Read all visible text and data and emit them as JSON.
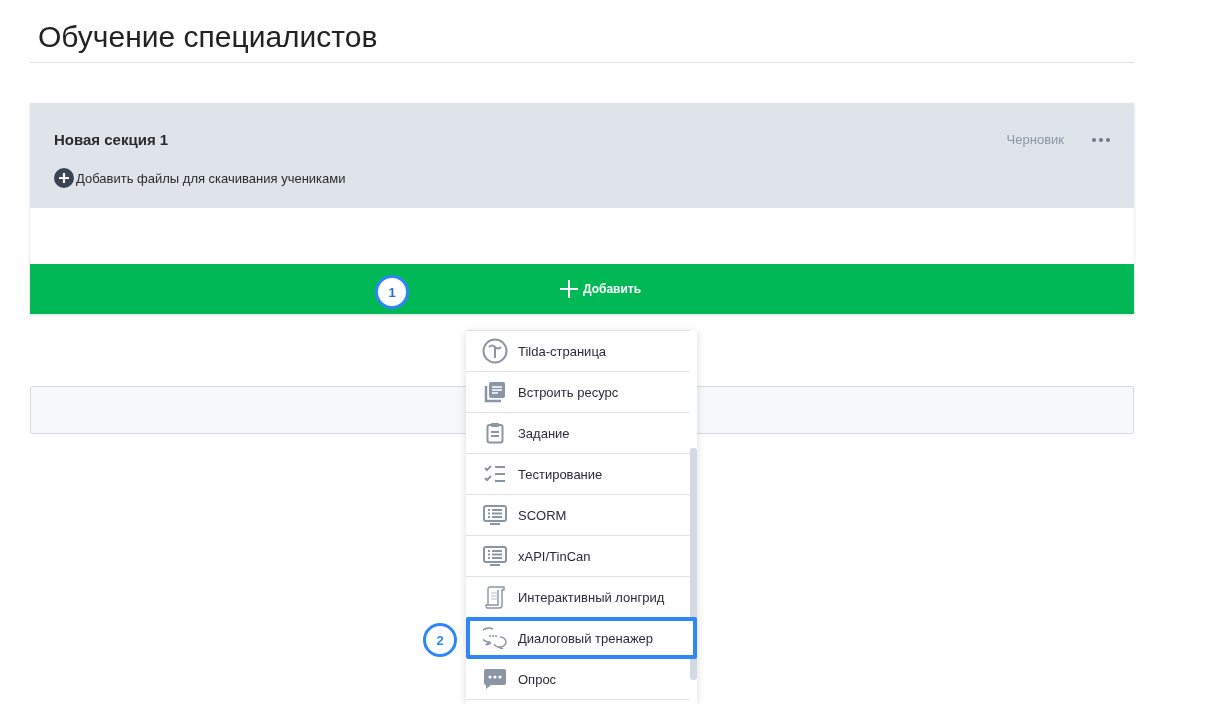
{
  "page": {
    "title": "Обучение специалистов"
  },
  "section": {
    "title": "Новая секция 1",
    "status": "Черновик",
    "add_files": "Добавить файлы для скачивания учениками",
    "add_button": "Добавить"
  },
  "menu": {
    "items": [
      {
        "label": "Tilda-страница",
        "selected": false
      },
      {
        "label": "Встроить ресурс",
        "selected": false
      },
      {
        "label": "Задание",
        "selected": false
      },
      {
        "label": "Тестирование",
        "selected": false
      },
      {
        "label": "SCORM",
        "selected": false
      },
      {
        "label": "xAPI/TinCan",
        "selected": false
      },
      {
        "label": "Интерактивный лонгрид",
        "selected": false
      },
      {
        "label": "Диалоговый тренажер",
        "selected": true
      },
      {
        "label": "Опрос",
        "selected": false
      }
    ]
  },
  "annotations": [
    "1",
    "2"
  ]
}
